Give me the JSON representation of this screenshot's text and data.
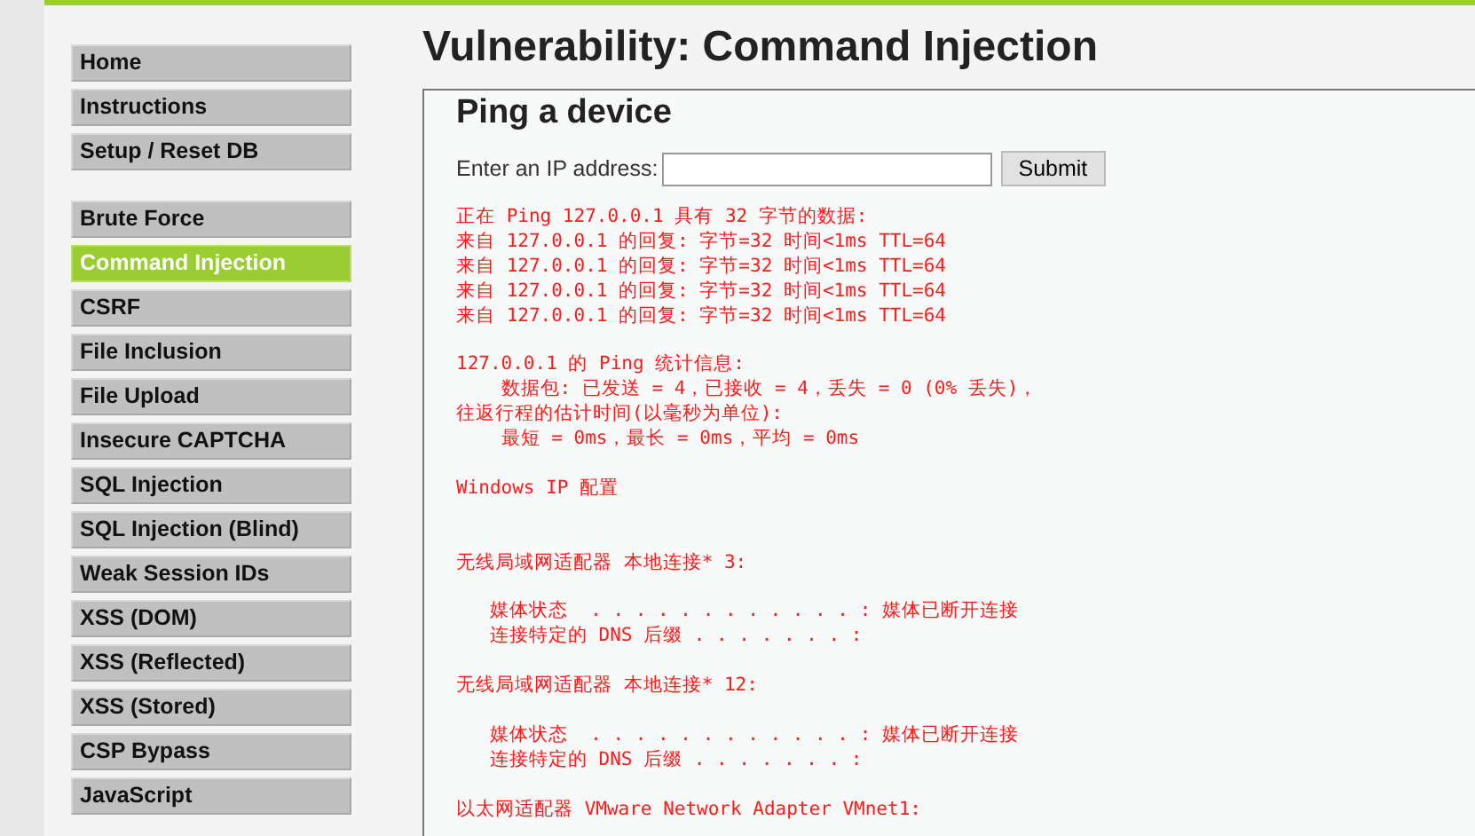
{
  "menu_groups": [
    {
      "items": [
        {
          "label": "Home",
          "selected": false
        },
        {
          "label": "Instructions",
          "selected": false
        },
        {
          "label": "Setup / Reset DB",
          "selected": false
        }
      ]
    },
    {
      "items": [
        {
          "label": "Brute Force",
          "selected": false
        },
        {
          "label": "Command Injection",
          "selected": true
        },
        {
          "label": "CSRF",
          "selected": false
        },
        {
          "label": "File Inclusion",
          "selected": false
        },
        {
          "label": "File Upload",
          "selected": false
        },
        {
          "label": "Insecure CAPTCHA",
          "selected": false
        },
        {
          "label": "SQL Injection",
          "selected": false
        },
        {
          "label": "SQL Injection (Blind)",
          "selected": false
        },
        {
          "label": "Weak Session IDs",
          "selected": false
        },
        {
          "label": "XSS (DOM)",
          "selected": false
        },
        {
          "label": "XSS (Reflected)",
          "selected": false
        },
        {
          "label": "XSS (Stored)",
          "selected": false
        },
        {
          "label": "CSP Bypass",
          "selected": false
        },
        {
          "label": "JavaScript",
          "selected": false
        }
      ]
    }
  ],
  "page_title": "Vulnerability: Command Injection",
  "panel": {
    "heading": "Ping a device",
    "field_label": "Enter an IP address:",
    "submit": "Submit",
    "output_blocks": [
      [
        "正在 Ping 127.0.0.1 具有 32 字节的数据:",
        "来自 127.0.0.1 的回复: 字节=32 时间<1ms TTL=64",
        "来自 127.0.0.1 的回复: 字节=32 时间<1ms TTL=64",
        "来自 127.0.0.1 的回复: 字节=32 时间<1ms TTL=64",
        "来自 127.0.0.1 的回复: 字节=32 时间<1ms TTL=64"
      ],
      [
        "127.0.0.1 的 Ping 统计信息:",
        "    数据包: 已发送 = 4，已接收 = 4，丢失 = 0 (0% 丢失)，",
        "往返行程的估计时间(以毫秒为单位):",
        "    最短 = 0ms，最长 = 0ms，平均 = 0ms"
      ],
      [
        "Windows IP 配置"
      ],
      [
        "无线局域网适配器 本地连接* 3:"
      ],
      [
        "   媒体状态  . . . . . . . . . . . . : 媒体已断开连接",
        "   连接特定的 DNS 后缀 . . . . . . . :"
      ],
      [
        "无线局域网适配器 本地连接* 12:"
      ],
      [
        "   媒体状态  . . . . . . . . . . . . : 媒体已断开连接",
        "   连接特定的 DNS 后缀 . . . . . . . :"
      ],
      [
        "以太网适配器 VMware Network Adapter VMnet1:"
      ]
    ]
  }
}
